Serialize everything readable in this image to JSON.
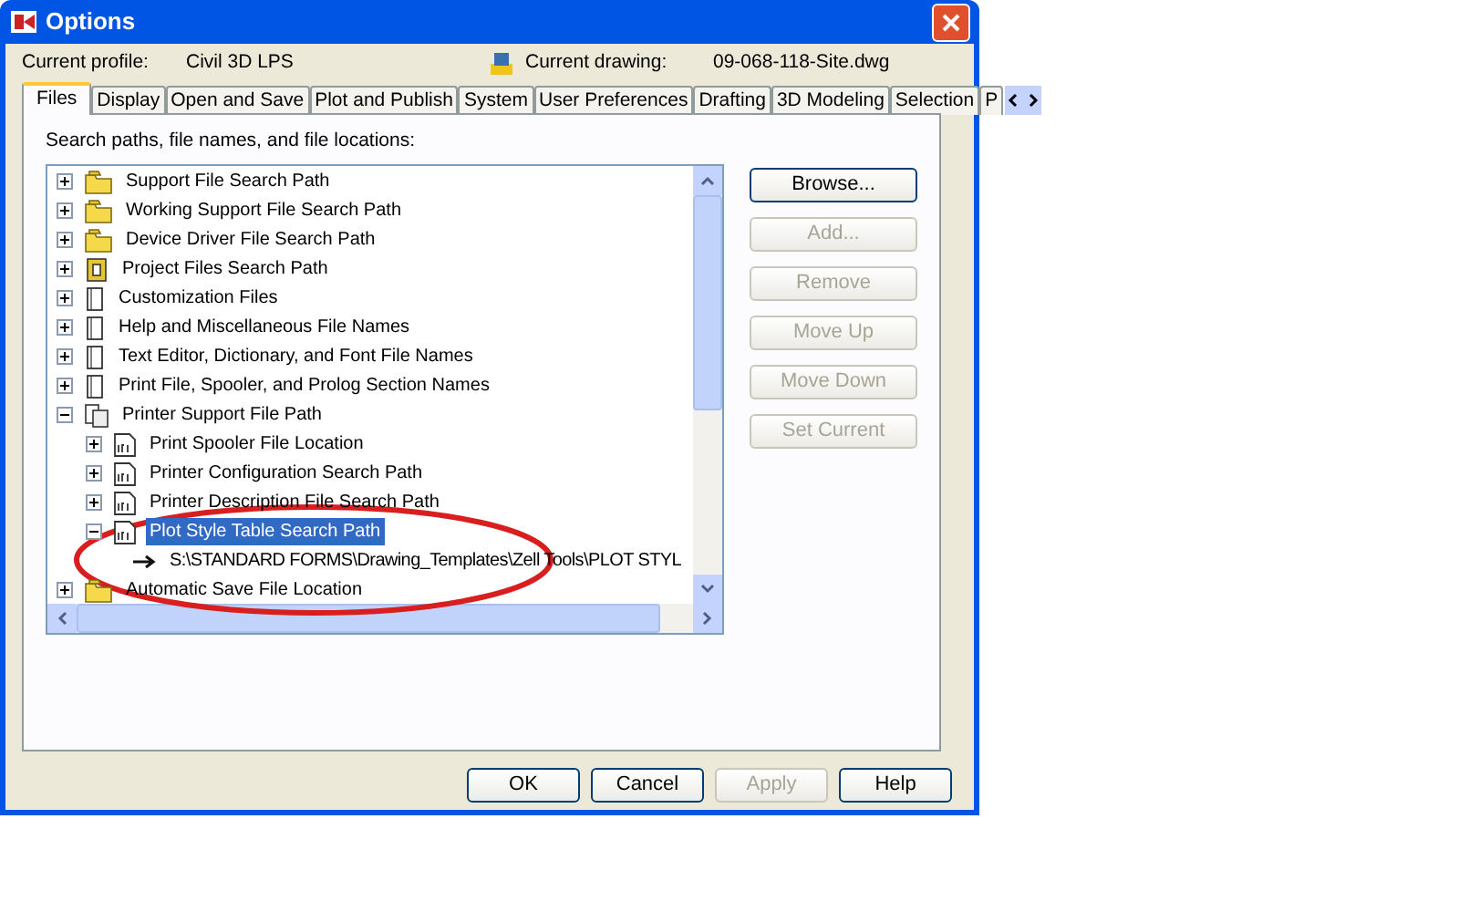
{
  "window": {
    "title": "Options"
  },
  "profile": {
    "label": "Current profile:",
    "value": "Civil 3D LPS"
  },
  "drawing": {
    "label": "Current drawing:",
    "value": "09-068-118-Site.dwg"
  },
  "tabs": [
    {
      "label": "Files",
      "selected": true
    },
    {
      "label": "Display",
      "selected": false
    },
    {
      "label": "Open and Save",
      "selected": false
    },
    {
      "label": "Plot and Publish",
      "selected": false
    },
    {
      "label": "System",
      "selected": false
    },
    {
      "label": "User Preferences",
      "selected": false
    },
    {
      "label": "Drafting",
      "selected": false
    },
    {
      "label": "3D Modeling",
      "selected": false
    },
    {
      "label": "Selection",
      "selected": false
    },
    {
      "label": "P",
      "selected": false
    }
  ],
  "tree_label": "Search paths, file names, and file locations:",
  "tree": [
    {
      "label": "Support File Search Path",
      "kind": "folder",
      "expanded": false,
      "selected": false
    },
    {
      "label": "Working Support File Search Path",
      "kind": "folder",
      "expanded": false,
      "selected": false
    },
    {
      "label": "Device Driver File Search Path",
      "kind": "folder",
      "expanded": false,
      "selected": false
    },
    {
      "label": "Project Files Search Path",
      "kind": "project",
      "expanded": false,
      "selected": false
    },
    {
      "label": "Customization Files",
      "kind": "file",
      "expanded": false,
      "selected": false
    },
    {
      "label": "Help and Miscellaneous File Names",
      "kind": "file",
      "expanded": false,
      "selected": false
    },
    {
      "label": "Text Editor, Dictionary, and Font File Names",
      "kind": "file",
      "expanded": false,
      "selected": false
    },
    {
      "label": "Print File, Spooler, and Prolog Section Names",
      "kind": "file",
      "expanded": false,
      "selected": false
    },
    {
      "label": "Printer Support File Path",
      "kind": "printer",
      "expanded": true,
      "selected": false,
      "children": [
        {
          "label": "Print Spooler File Location",
          "kind": "plt",
          "expanded": false,
          "selected": false
        },
        {
          "label": "Printer Configuration Search Path",
          "kind": "plt",
          "expanded": false,
          "selected": false
        },
        {
          "label": "Printer Description File Search Path",
          "kind": "plt",
          "expanded": false,
          "selected": false
        },
        {
          "label": "Plot Style Table Search Path",
          "kind": "plt",
          "expanded": true,
          "selected": true,
          "children": [
            {
              "label": "S:\\STANDARD FORMS\\Drawing_Templates\\Zell Tools\\PLOT STYL",
              "kind": "path",
              "selected": false
            }
          ]
        }
      ]
    },
    {
      "label": "Automatic Save File Location",
      "kind": "folder",
      "expanded": false,
      "selected": false
    }
  ],
  "side_buttons": [
    {
      "label": "Browse...",
      "disabled": false
    },
    {
      "label": "Add...",
      "disabled": true
    },
    {
      "label": "Remove",
      "disabled": true
    },
    {
      "label": "Move Up",
      "disabled": true
    },
    {
      "label": "Move Down",
      "disabled": true
    },
    {
      "label": "Set Current",
      "disabled": true
    }
  ],
  "buttons": [
    {
      "label": "OK",
      "disabled": false
    },
    {
      "label": "Cancel",
      "disabled": false
    },
    {
      "label": "Apply",
      "disabled": true
    },
    {
      "label": "Help",
      "disabled": false
    }
  ]
}
